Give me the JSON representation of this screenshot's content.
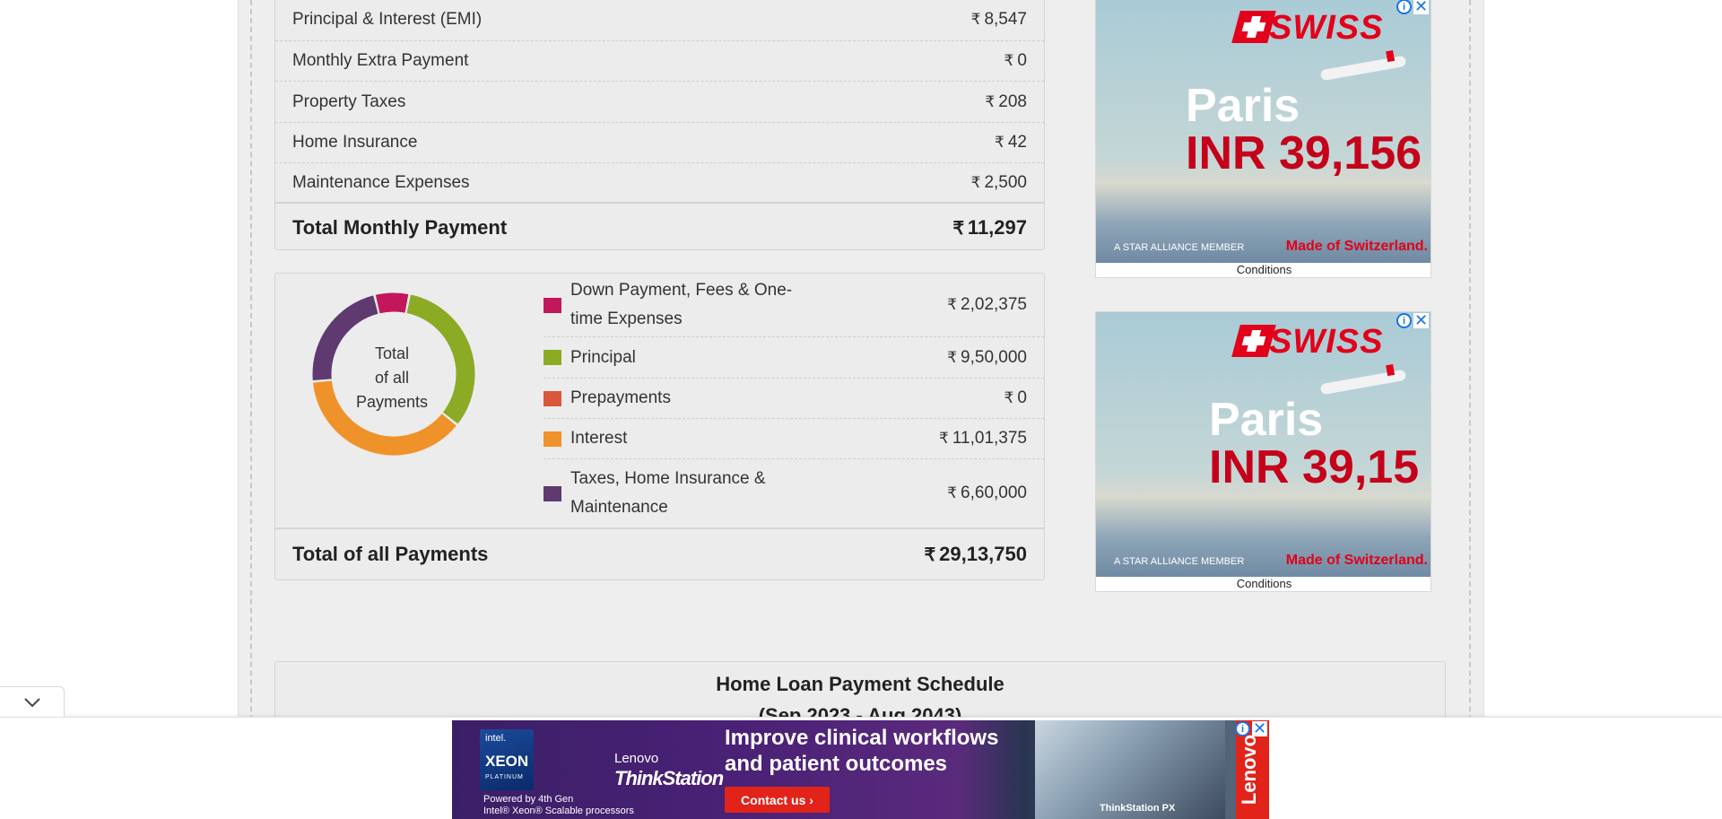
{
  "monthly": {
    "rows": [
      {
        "label": "Principal & Interest (EMI)",
        "value": "8,547"
      },
      {
        "label": "Monthly Extra Payment",
        "value": "0"
      },
      {
        "label": "Property Taxes",
        "value": "208"
      },
      {
        "label": "Home Insurance",
        "value": "42"
      },
      {
        "label": "Maintenance Expenses",
        "value": "2,500"
      }
    ],
    "total_label": "Total Monthly Payment",
    "total_value": "11,297"
  },
  "currency_symbol": "₹",
  "breakdown": {
    "center_lines": [
      "Total",
      "of all",
      "Payments"
    ],
    "items": [
      {
        "label": "Down Payment, Fees & One-time Expenses",
        "value": "2,02,375",
        "color": "#c2185b",
        "amount": 202375
      },
      {
        "label": "Principal",
        "value": "9,50,000",
        "color": "#8bab25",
        "amount": 950000
      },
      {
        "label": "Prepayments",
        "value": "0",
        "color": "#d9573a",
        "amount": 0
      },
      {
        "label": "Interest",
        "value": "11,01,375",
        "color": "#f0922a",
        "amount": 1101375
      },
      {
        "label": "Taxes, Home Insurance & Maintenance",
        "value": "6,60,000",
        "color": "#5e3a70",
        "amount": 660000
      }
    ],
    "total_label": "Total of all Payments",
    "total_value": "29,13,750"
  },
  "ads": [
    {
      "brand": "SWISS",
      "city": "Paris",
      "price": "INR 39,156",
      "alliance": "A STAR ALLIANCE MEMBER",
      "tagline": "Made of Switzerland.",
      "conditions": "Conditions"
    },
    {
      "brand": "SWISS",
      "city": "Paris",
      "price": "INR 39,15",
      "alliance": "A STAR ALLIANCE MEMBER",
      "tagline": "Made of Switzerland.",
      "conditions": "Conditions"
    }
  ],
  "schedule": {
    "title": "Home Loan Payment Schedule",
    "subtitle": "(Sep 2023 - Aug 2043)"
  },
  "bottom_ad": {
    "intel": "intel.",
    "xeon": "XEON",
    "platinum": "PLATINUM",
    "lenovo": "Lenovo",
    "thinkstation": "ThinkStation",
    "powered_line1": "Powered by 4th Gen",
    "powered_line2": "Intel® Xeon® Scalable processors",
    "headline_line1": "Improve clinical workflows",
    "headline_line2": "and patient outcomes",
    "cta": "Contact us ›",
    "product": "ThinkStation PX",
    "vertical_brand": "Lenovo"
  },
  "icons": {
    "info": "info-icon",
    "close": "close-icon",
    "collapse": "chevron-down-icon"
  }
}
